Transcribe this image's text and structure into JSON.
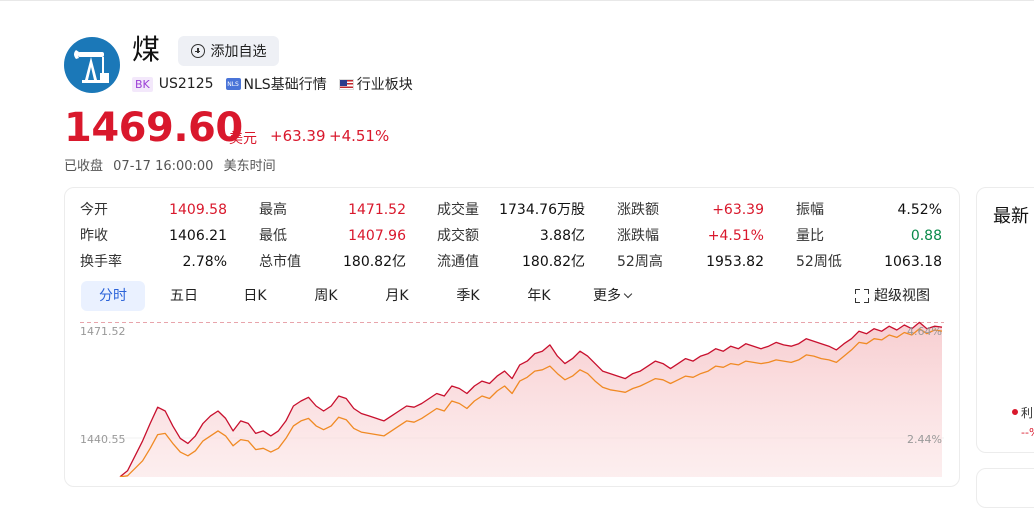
{
  "header": {
    "title": "煤",
    "add_watch_label": "添加自选",
    "tag_bk": "BK",
    "code": "US2125",
    "nls_label": "NLS基础行情",
    "sector_label": "行业板块"
  },
  "quote": {
    "price": "1469.60",
    "currency": "美元",
    "change": "+63.39",
    "change_pct": "+4.51%",
    "status": "已收盘",
    "datetime": "07-17 16:00:00",
    "timezone": "美东时间"
  },
  "stats": [
    [
      {
        "label": "今开",
        "value": "1409.58",
        "color": "red"
      },
      {
        "label": "最高",
        "value": "1471.52",
        "color": "red"
      },
      {
        "label": "成交量",
        "value": "1734.76万股",
        "color": ""
      },
      {
        "label": "涨跌额",
        "value": "+63.39",
        "color": "red"
      },
      {
        "label": "振幅",
        "value": "4.52%",
        "color": ""
      }
    ],
    [
      {
        "label": "昨收",
        "value": "1406.21",
        "color": ""
      },
      {
        "label": "最低",
        "value": "1407.96",
        "color": "red"
      },
      {
        "label": "成交额",
        "value": "3.88亿",
        "color": ""
      },
      {
        "label": "涨跌幅",
        "value": "+4.51%",
        "color": "red"
      },
      {
        "label": "量比",
        "value": "0.88",
        "color": "green"
      }
    ],
    [
      {
        "label": "换手率",
        "value": "2.78%",
        "color": ""
      },
      {
        "label": "总市值",
        "value": "180.82亿",
        "color": ""
      },
      {
        "label": "流通值",
        "value": "180.82亿",
        "color": ""
      },
      {
        "label": "52周高",
        "value": "1953.82",
        "color": ""
      },
      {
        "label": "52周低",
        "value": "1063.18",
        "color": ""
      }
    ]
  ],
  "tabs": [
    "分时",
    "五日",
    "日K",
    "周K",
    "月K",
    "季K",
    "年K",
    "更多"
  ],
  "active_tab": 0,
  "fullscreen_label": "超级视图",
  "side_panel": {
    "title": "最新",
    "legend_label": "利",
    "legend_value": "--%"
  },
  "colors": {
    "up": "#d9182c",
    "down": "#0a8a4a",
    "price_line": "#c8102e",
    "avg_line": "#f08a24",
    "accent": "#2b63d9"
  },
  "chart_data": {
    "type": "line",
    "y_tick_labels_left": [
      "1471.52",
      "1440.55"
    ],
    "y_tick_labels_right": [
      "4.64%",
      "2.44%"
    ],
    "ylim": [
      1409.5,
      1472.5
    ],
    "reference_high": 1471.52,
    "series": [
      {
        "values": [
          1409.6,
          1412.0,
          1418.0,
          1424.0,
          1431.0,
          1437.5,
          1436.0,
          1430.0,
          1425.0,
          1423.0,
          1426.0,
          1431.0,
          1434.0,
          1436.0,
          1433.0,
          1428.0,
          1432.0,
          1431.0,
          1427.0,
          1428.0,
          1426.0,
          1428.0,
          1432.0,
          1438.0,
          1440.0,
          1441.5,
          1438.0,
          1436.0,
          1438.0,
          1442.0,
          1441.0,
          1437.0,
          1435.0,
          1434.0,
          1433.0,
          1432.0,
          1434.0,
          1436.0,
          1438.0,
          1437.5,
          1439.0,
          1441.0,
          1443.0,
          1442.0,
          1446.0,
          1445.0,
          1443.0,
          1446.0,
          1448.0,
          1447.0,
          1450.0,
          1452.0,
          1449.0,
          1454.5,
          1456.0,
          1459.0,
          1460.0,
          1462.5,
          1458.0,
          1455.0,
          1457.0,
          1460.0,
          1458.0,
          1455.0,
          1452.0,
          1451.0,
          1450.0,
          1449.0,
          1451.0,
          1452.0,
          1454.0,
          1456.0,
          1455.0,
          1453.0,
          1455.0,
          1457.0,
          1456.0,
          1458.0,
          1459.0,
          1461.0,
          1460.0,
          1462.0,
          1461.0,
          1463.0,
          1462.0,
          1461.0,
          1462.0,
          1463.5,
          1462.5,
          1462.0,
          1463.0,
          1465.0,
          1464.0,
          1463.0,
          1462.0,
          1460.5,
          1463.0,
          1465.0,
          1468.0,
          1467.0,
          1469.0,
          1468.0,
          1470.0,
          1468.5,
          1470.5,
          1469.0,
          1471.52,
          1469.0,
          1470.0,
          1469.6
        ],
        "color_key": "price_line"
      },
      {
        "values": [
          1409.6,
          1410.0,
          1413.0,
          1416.0,
          1421.0,
          1426.5,
          1427.0,
          1423.0,
          1419.5,
          1418.0,
          1420.0,
          1424.0,
          1426.0,
          1428.0,
          1426.0,
          1422.0,
          1424.5,
          1424.0,
          1420.5,
          1421.0,
          1419.5,
          1421.0,
          1425.0,
          1430.0,
          1432.0,
          1433.0,
          1430.0,
          1428.5,
          1430.0,
          1433.5,
          1432.5,
          1429.0,
          1427.5,
          1427.0,
          1426.5,
          1426.0,
          1428.0,
          1430.0,
          1432.0,
          1431.5,
          1433.0,
          1435.0,
          1437.0,
          1436.0,
          1440.0,
          1439.0,
          1437.0,
          1440.0,
          1442.0,
          1441.0,
          1444.0,
          1446.0,
          1443.0,
          1448.0,
          1449.5,
          1452.0,
          1452.5,
          1454.0,
          1451.0,
          1448.5,
          1450.0,
          1452.5,
          1451.0,
          1448.0,
          1445.5,
          1444.5,
          1444.0,
          1443.5,
          1445.0,
          1446.0,
          1447.5,
          1449.0,
          1448.5,
          1447.0,
          1448.5,
          1450.0,
          1449.5,
          1451.0,
          1452.0,
          1454.0,
          1453.5,
          1455.0,
          1454.5,
          1456.0,
          1455.5,
          1455.0,
          1455.5,
          1456.5,
          1456.0,
          1455.5,
          1456.5,
          1458.5,
          1458.0,
          1457.0,
          1456.5,
          1455.5,
          1458.0,
          1460.5,
          1463.5,
          1463.0,
          1465.0,
          1464.5,
          1466.5,
          1465.5,
          1467.5,
          1466.5,
          1469.0,
          1467.0,
          1468.5,
          1468.0
        ],
        "color_key": "avg_line"
      }
    ]
  }
}
